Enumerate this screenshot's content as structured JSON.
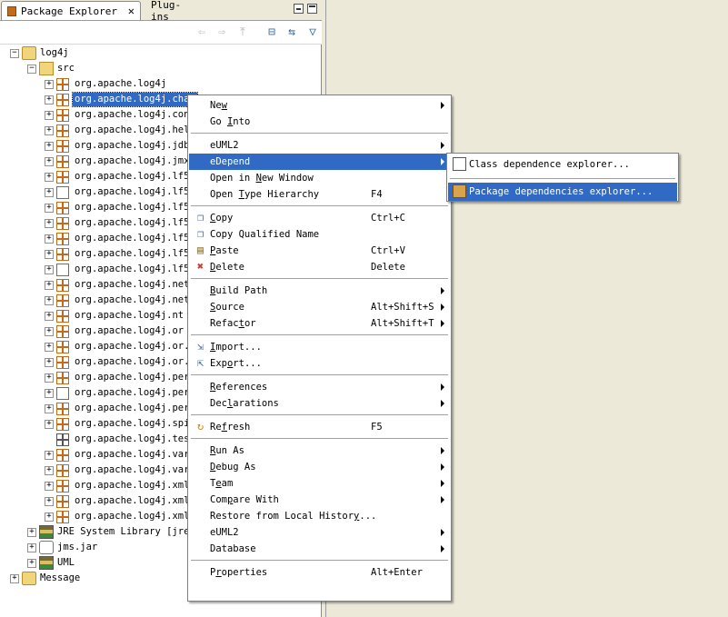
{
  "tabs": [
    {
      "label": "Package Explorer",
      "active": true,
      "close": "✕"
    },
    {
      "label": "Plug-ins",
      "active": false
    }
  ],
  "toolbar": {
    "icons": [
      "back-icon",
      "forward-icon",
      "up-icon",
      "collapse-all-icon",
      "link-editor-icon",
      "view-menu-icon"
    ],
    "glyphs": [
      "⇦",
      "⇨",
      "⤒",
      "⊟",
      "⇆",
      "▽"
    ]
  },
  "tree": [
    {
      "label": "log4j",
      "expander": "−",
      "icon": "project-icon"
    },
    {
      "label": "src",
      "expander": "−",
      "icon": "source-folder-icon"
    },
    {
      "label": "org.apache.log4j",
      "expander": "+",
      "icon": "package-icon"
    },
    {
      "label": "org.apache.log4j.chai",
      "expander": "+",
      "icon": "package-icon",
      "selected": true
    },
    {
      "label": "org.apache.log4j.con:",
      "expander": "+",
      "icon": "package-icon"
    },
    {
      "label": "org.apache.log4j.help",
      "expander": "+",
      "icon": "package-icon"
    },
    {
      "label": "org.apache.log4j.jdbc",
      "expander": "+",
      "icon": "package-icon"
    },
    {
      "label": "org.apache.log4j.jmx",
      "expander": "+",
      "icon": "package-icon"
    },
    {
      "label": "org.apache.log4j.lf5",
      "expander": "+",
      "icon": "package-icon"
    },
    {
      "label": "org.apache.log4j.lf5.",
      "expander": "+",
      "icon": "package-other-icon"
    },
    {
      "label": "org.apache.log4j.lf5.",
      "expander": "+",
      "icon": "package-icon"
    },
    {
      "label": "org.apache.log4j.lf5.",
      "expander": "+",
      "icon": "package-icon"
    },
    {
      "label": "org.apache.log4j.lf5.",
      "expander": "+",
      "icon": "package-icon"
    },
    {
      "label": "org.apache.log4j.lf5.",
      "expander": "+",
      "icon": "package-icon"
    },
    {
      "label": "org.apache.log4j.lf5.",
      "expander": "+",
      "icon": "package-other-icon"
    },
    {
      "label": "org.apache.log4j.net",
      "expander": "+",
      "icon": "package-icon"
    },
    {
      "label": "org.apache.log4j.net.",
      "expander": "+",
      "icon": "package-icon"
    },
    {
      "label": "org.apache.log4j.nt",
      "expander": "+",
      "icon": "package-icon"
    },
    {
      "label": "org.apache.log4j.or",
      "expander": "+",
      "icon": "package-icon"
    },
    {
      "label": "org.apache.log4j.or.",
      "expander": "+",
      "icon": "package-icon"
    },
    {
      "label": "org.apache.log4j.or.:",
      "expander": "+",
      "icon": "package-icon"
    },
    {
      "label": "org.apache.log4j.pers",
      "expander": "+",
      "icon": "package-icon"
    },
    {
      "label": "org.apache.log4j.pers",
      "expander": "+",
      "icon": "package-other-icon"
    },
    {
      "label": "org.apache.log4j.pers",
      "expander": "+",
      "icon": "package-icon"
    },
    {
      "label": "org.apache.log4j.spi",
      "expander": "+",
      "icon": "package-icon"
    },
    {
      "label": "org.apache.log4j.test",
      "expander": "",
      "icon": "package-empty-icon"
    },
    {
      "label": "org.apache.log4j.vari",
      "expander": "+",
      "icon": "package-icon"
    },
    {
      "label": "org.apache.log4j.vari",
      "expander": "+",
      "icon": "package-icon"
    },
    {
      "label": "org.apache.log4j.xml",
      "expander": "+",
      "icon": "package-icon"
    },
    {
      "label": "org.apache.log4j.xml.",
      "expander": "+",
      "icon": "package-icon"
    },
    {
      "label": "org.apache.log4j.xml.",
      "expander": "+",
      "icon": "package-icon"
    },
    {
      "label": "JRE System Library [jre1",
      "expander": "+",
      "icon": "library-icon"
    },
    {
      "label": "jms.jar",
      "expander": "+",
      "icon": "jar-icon"
    },
    {
      "label": "UML",
      "expander": "+",
      "icon": "library-icon"
    },
    {
      "label": "Message",
      "expander": "+",
      "icon": "project-icon"
    }
  ],
  "context_menu": {
    "items": [
      {
        "type": "item",
        "label": "New",
        "mnemonic": "w",
        "accel": "",
        "submenu": true
      },
      {
        "type": "item",
        "label": "Go Into",
        "mnemonic": "I",
        "accel": ""
      },
      {
        "type": "sep"
      },
      {
        "type": "item",
        "label": "eUML2",
        "accel": "",
        "submenu": true
      },
      {
        "type": "item",
        "label": "eDepend",
        "accel": "",
        "submenu": true,
        "highlighted": true
      },
      {
        "type": "item",
        "label": "Open in New Window",
        "mnemonic": "N",
        "accel": ""
      },
      {
        "type": "item",
        "label": "Open Type Hierarchy",
        "mnemonic": "T",
        "accel": "F4"
      },
      {
        "type": "sep"
      },
      {
        "type": "item",
        "label": "Copy",
        "mnemonic": "C",
        "accel": "Ctrl+C",
        "icon": "copy-icon"
      },
      {
        "type": "item",
        "label": "Copy Qualified Name",
        "accel": "",
        "icon": "copy-qualified-name-icon"
      },
      {
        "type": "item",
        "label": "Paste",
        "mnemonic": "P",
        "accel": "Ctrl+V",
        "icon": "paste-icon"
      },
      {
        "type": "item",
        "label": "Delete",
        "mnemonic": "D",
        "accel": "Delete",
        "icon": "delete-icon"
      },
      {
        "type": "sep"
      },
      {
        "type": "item",
        "label": "Build Path",
        "mnemonic": "B",
        "accel": "",
        "submenu": true
      },
      {
        "type": "item",
        "label": "Source",
        "mnemonic": "S",
        "accel": "Alt+Shift+S",
        "submenu": true
      },
      {
        "type": "item",
        "label": "Refactor",
        "mnemonic": "t",
        "accel": "Alt+Shift+T",
        "submenu": true
      },
      {
        "type": "sep"
      },
      {
        "type": "item",
        "label": "Import...",
        "mnemonic": "I",
        "accel": "",
        "icon": "import-icon"
      },
      {
        "type": "item",
        "label": "Export...",
        "mnemonic": "o",
        "accel": "",
        "icon": "export-icon"
      },
      {
        "type": "sep"
      },
      {
        "type": "item",
        "label": "References",
        "mnemonic": "R",
        "accel": "",
        "submenu": true
      },
      {
        "type": "item",
        "label": "Declarations",
        "mnemonic": "l",
        "accel": "",
        "submenu": true
      },
      {
        "type": "sep"
      },
      {
        "type": "item",
        "label": "Refresh",
        "mnemonic": "f",
        "accel": "F5",
        "icon": "refresh-icon"
      },
      {
        "type": "sep"
      },
      {
        "type": "item",
        "label": "Run As",
        "mnemonic": "R",
        "accel": "",
        "submenu": true
      },
      {
        "type": "item",
        "label": "Debug As",
        "mnemonic": "D",
        "accel": "",
        "submenu": true
      },
      {
        "type": "item",
        "label": "Team",
        "mnemonic": "e",
        "accel": "",
        "submenu": true
      },
      {
        "type": "item",
        "label": "Compare With",
        "mnemonic": "p",
        "accel": "",
        "submenu": true
      },
      {
        "type": "item",
        "label": "Restore from Local History...",
        "mnemonic": "y",
        "accel": ""
      },
      {
        "type": "item",
        "label": "eUML2",
        "accel": "",
        "submenu": true
      },
      {
        "type": "item",
        "label": "Database",
        "accel": "",
        "submenu": true
      },
      {
        "type": "sep"
      },
      {
        "type": "item",
        "label": "Properties",
        "mnemonic": "r",
        "accel": "Alt+Enter"
      }
    ]
  },
  "submenu": {
    "items": [
      {
        "label": "Class dependence explorer...",
        "icon": "class-dependence-icon",
        "highlighted": false
      },
      {
        "type": "sep"
      },
      {
        "label": "Package dependencies explorer...",
        "icon": "package-dependencies-icon",
        "highlighted": true
      }
    ]
  },
  "colors": {
    "highlight": "#316ac5",
    "chrome": "#ece9d8",
    "package": "#c26b1c"
  }
}
